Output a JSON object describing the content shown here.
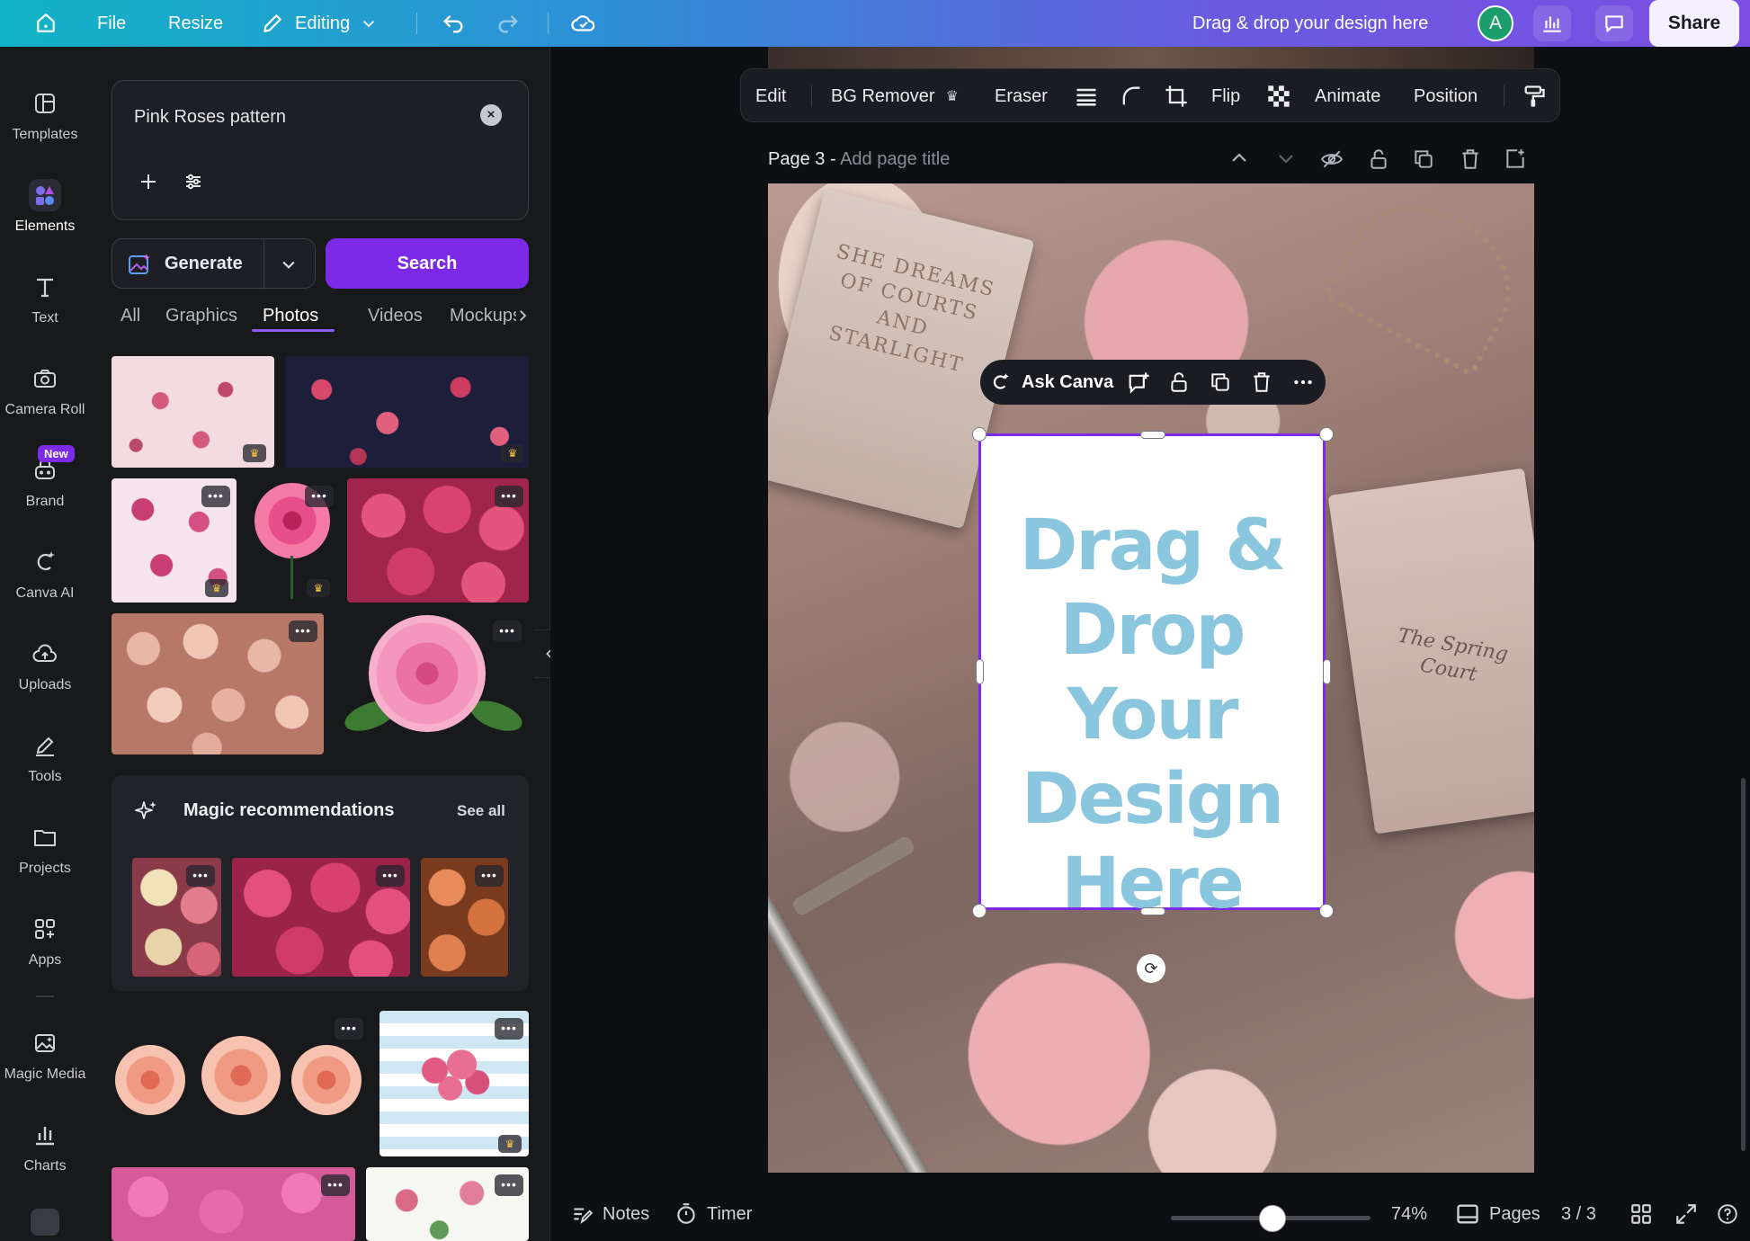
{
  "topbar": {
    "file": "File",
    "resize": "Resize",
    "editing": "Editing",
    "design_hint": "Drag & drop your design here",
    "avatar_initial": "A",
    "share": "Share"
  },
  "rail": {
    "items": [
      {
        "label": "Templates"
      },
      {
        "label": "Elements"
      },
      {
        "label": "Text"
      },
      {
        "label": "Camera Roll"
      },
      {
        "label": "Brand",
        "badge": "New"
      },
      {
        "label": "Canva AI"
      },
      {
        "label": "Uploads"
      },
      {
        "label": "Tools"
      },
      {
        "label": "Projects"
      },
      {
        "label": "Apps"
      },
      {
        "label": "Magic Media"
      },
      {
        "label": "Charts"
      }
    ]
  },
  "panel": {
    "search_value": "Pink Roses pattern",
    "generate": "Generate",
    "search_button": "Search",
    "tabs": [
      {
        "label": "All"
      },
      {
        "label": "Graphics"
      },
      {
        "label": "Photos"
      },
      {
        "label": "Videos"
      },
      {
        "label": "Mockups"
      }
    ],
    "magic_title": "Magic recommendations",
    "magic_see_all": "See all"
  },
  "toolbar": {
    "edit": "Edit",
    "bg_remover": "BG Remover",
    "eraser": "Eraser",
    "flip": "Flip",
    "animate": "Animate",
    "position": "Position"
  },
  "page": {
    "label": "Page 3 -",
    "title_placeholder": "Add page title"
  },
  "canvas": {
    "ask_canva": "Ask Canva",
    "frame_text": "Drag & Drop Your Design Here",
    "book1_text": "SHE DREAMS OF COURTS AND STARLIGHT",
    "book2_text": "The Spring Court"
  },
  "bottombar": {
    "notes": "Notes",
    "timer": "Timer",
    "zoom": "74%",
    "zoom_fraction": 0.74,
    "pages": "Pages",
    "page_count": "3 / 3"
  },
  "colors": {
    "accent": "#7d2ae8",
    "frame_text": "#8ac6de"
  }
}
